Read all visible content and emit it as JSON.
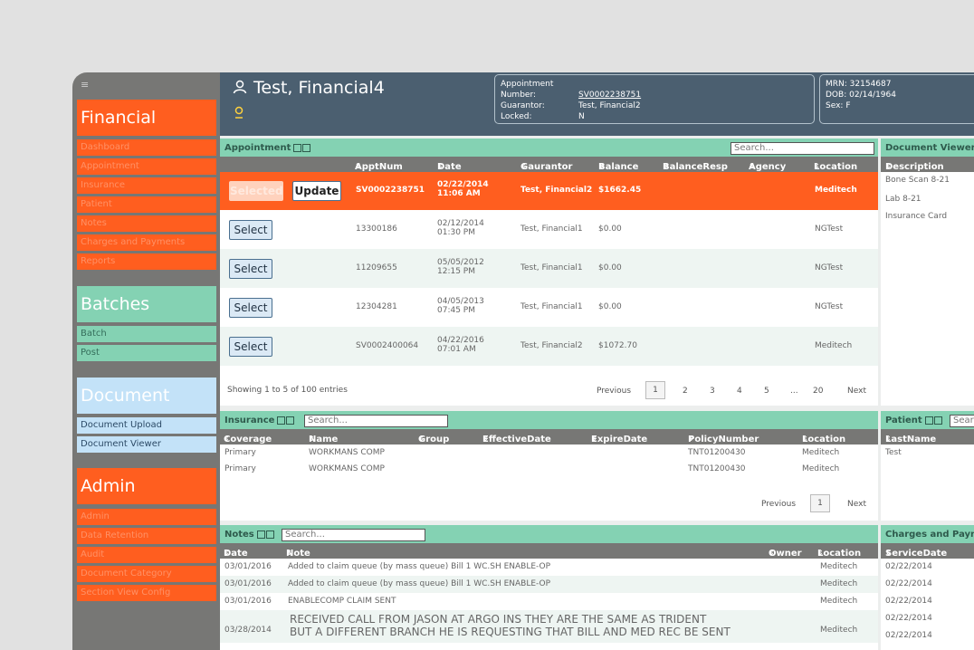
{
  "sidebar": {
    "financial_title": "Financial",
    "financial_items": [
      "Dashboard",
      "Appointment",
      "Insurance",
      "Patient",
      "Notes",
      "Charges and Payments",
      "Reports"
    ],
    "batches_title": "Batches",
    "batches_items": [
      "Batch",
      "Post"
    ],
    "document_title": "Document",
    "document_items": [
      "Document Upload",
      "Document Viewer"
    ],
    "admin_title": "Admin",
    "admin_items": [
      "Admin",
      "Data Retention",
      "Audit",
      "Document Category",
      "Section View Config"
    ]
  },
  "header": {
    "patient_name": "Test, Financial4",
    "appointment_number_label": "Appointment Number:",
    "appointment_number": "SV0002238751",
    "guarantor_label": "Guarantor:",
    "guarantor": "Test, Financial2",
    "locked_label": "Locked:",
    "locked": "N",
    "mrn_label": "MRN:",
    "mrn": "32154687",
    "dob_label": "DOB:",
    "dob": "02/14/1964",
    "sex_label": "Sex:",
    "sex": "F"
  },
  "appointment": {
    "title": "Appointment",
    "search_placeholder": "Search...",
    "columns": [
      "ApptNum",
      "Date",
      "Gaurantor",
      "Balance",
      "BalanceResp",
      "Agency",
      "Location"
    ],
    "selected_label": "Selected",
    "update_label": "Update",
    "select_label": "Select",
    "rows": [
      {
        "num": "SV0002238751",
        "date": "02/22/2014",
        "time": "11:06 AM",
        "guarantor": "Test, Financial2",
        "balance": "$1662.45",
        "location": "Meditech"
      },
      {
        "num": "13300186",
        "date": "02/12/2014",
        "time": "01:30 PM",
        "guarantor": "Test, Financial1",
        "balance": "$0.00",
        "location": "NGTest"
      },
      {
        "num": "11209655",
        "date": "05/05/2012",
        "time": "12:15 PM",
        "guarantor": "Test, Financial1",
        "balance": "$0.00",
        "location": "NGTest"
      },
      {
        "num": "12304281",
        "date": "04/05/2013",
        "time": "07:45 PM",
        "guarantor": "Test, Financial1",
        "balance": "$0.00",
        "location": "NGTest"
      },
      {
        "num": "SV0002400064",
        "date": "04/22/2016",
        "time": "07:01 AM",
        "guarantor": "Test, Financial2",
        "balance": "$1072.70",
        "location": "Meditech"
      }
    ],
    "showing": "Showing 1 to 5 of 100 entries",
    "pagination": {
      "previous": "Previous",
      "pages": [
        "1",
        "2",
        "3",
        "4",
        "5",
        "...",
        "20"
      ],
      "next": "Next"
    }
  },
  "document_viewer": {
    "title": "Document Viewer",
    "column": "Description",
    "rows": [
      "Bone Scan 8-21",
      "Lab 8-21",
      "Insurance Card"
    ]
  },
  "insurance": {
    "title": "Insurance",
    "search_placeholder": "Search...",
    "columns": [
      "Coverage",
      "Name",
      "Group",
      "EffectiveDate",
      "ExpireDate",
      "PolicyNumber",
      "Location"
    ],
    "rows": [
      {
        "coverage": "Primary",
        "name": "WORKMANS COMP",
        "policy": "TNT01200430",
        "location": "Meditech"
      },
      {
        "coverage": "Primary",
        "name": "WORKMANS COMP",
        "policy": "TNT01200430",
        "location": "Meditech"
      }
    ],
    "pagination": {
      "previous": "Previous",
      "page": "1",
      "next": "Next"
    }
  },
  "patient": {
    "title": "Patient",
    "search_placeholder": "Sear",
    "column": "LastName",
    "rows": [
      "Test"
    ]
  },
  "notes": {
    "title": "Notes",
    "search_placeholder": "Search...",
    "columns": [
      "Date",
      "Note",
      "Owner",
      "Location"
    ],
    "rows": [
      {
        "date": "03/01/2016",
        "note": "Added to claim queue (by mass queue) Bill 1 WC.SH ENABLE-OP",
        "location": "Meditech"
      },
      {
        "date": "03/01/2016",
        "note": "Added to claim queue (by mass queue) Bill 1 WC.SH ENABLE-OP",
        "location": "Meditech"
      },
      {
        "date": "03/01/2016",
        "note": "ENABLECOMP CLAIM SENT",
        "location": "Meditech"
      }
    ],
    "long_note_line1": "RECEIVED CALL FROM JASON AT ARGO INS THEY ARE THE SAME AS TRIDENT",
    "long_note_line2": "BUT A DIFFERENT BRANCH HE IS REQUESTING THAT BILL AND MED REC BE SENT",
    "long_note_date": "03/28/2014",
    "long_note_location": "Meditech"
  },
  "charges": {
    "title": "Charges and Payn",
    "column": "ServiceDate",
    "rows": [
      "02/22/2014",
      "02/22/2014",
      "02/22/2014",
      "02/22/2014",
      "02/22/2014"
    ]
  }
}
